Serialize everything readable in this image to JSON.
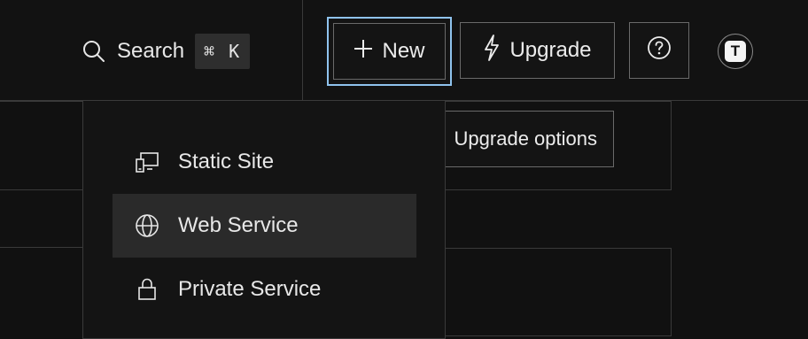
{
  "header": {
    "search": {
      "label": "Search",
      "shortcut": "⌘ K",
      "icon": "search-icon"
    },
    "new_button": {
      "label": "New",
      "icon": "plus-icon"
    },
    "upgrade_button": {
      "label": "Upgrade",
      "icon": "lightning-icon"
    },
    "help_button": {
      "icon": "help-icon"
    },
    "avatar": {
      "initial": "T"
    }
  },
  "background": {
    "upgrade_options_label": "Upgrade options"
  },
  "new_menu": {
    "items": [
      {
        "label": "Static Site",
        "icon": "static-site-icon",
        "highlighted": false
      },
      {
        "label": "Web Service",
        "icon": "globe-icon",
        "highlighted": true
      },
      {
        "label": "Private Service",
        "icon": "lock-icon",
        "highlighted": false
      }
    ]
  },
  "colors": {
    "focus_ring": "#8fc3ee",
    "background": "#111111",
    "highlight": "#2a2a2a"
  }
}
